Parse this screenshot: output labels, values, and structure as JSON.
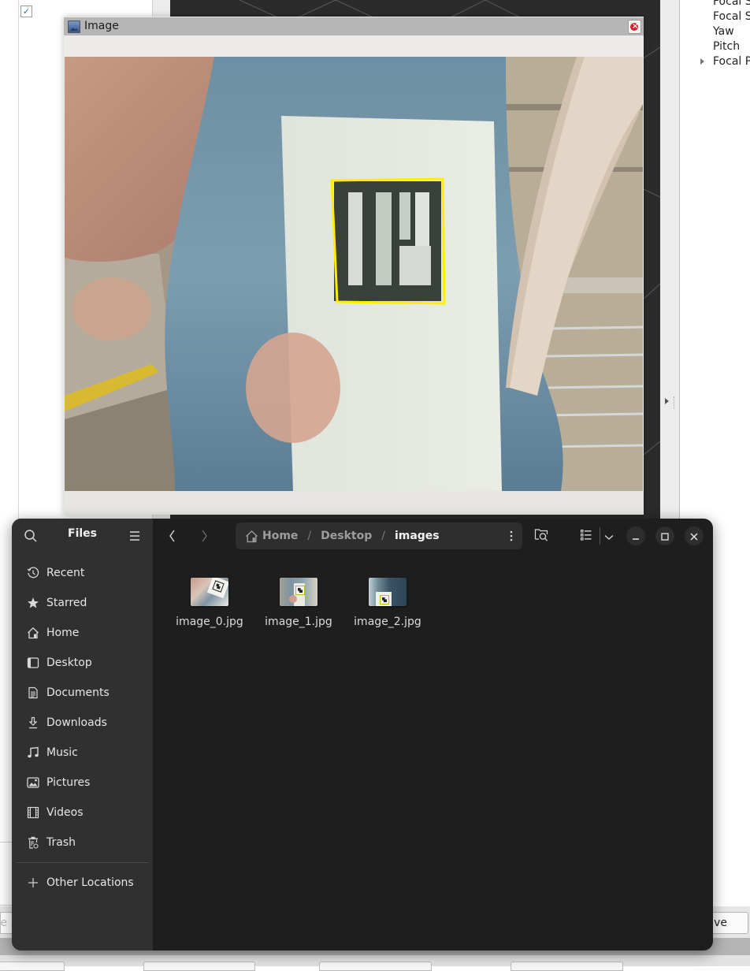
{
  "background_app": {
    "checkbox_checked": true,
    "properties": [
      {
        "label": "Focal S",
        "expandable": false
      },
      {
        "label": "Focal S",
        "expandable": false
      },
      {
        "label": "Yaw",
        "expandable": false
      },
      {
        "label": "Pitch",
        "expandable": false
      },
      {
        "label": "Focal P",
        "expandable": true
      }
    ],
    "partial_field_text": "te",
    "partial_button_text": "ve"
  },
  "image_window": {
    "title": "Image",
    "detection_box_color": "#ffee00"
  },
  "files_window": {
    "app_title": "Files",
    "sidebar": {
      "items": [
        {
          "label": "Recent",
          "icon": "clock-icon"
        },
        {
          "label": "Starred",
          "icon": "star-icon"
        },
        {
          "label": "Home",
          "icon": "home-icon"
        },
        {
          "label": "Desktop",
          "icon": "desktop-icon"
        },
        {
          "label": "Documents",
          "icon": "document-icon"
        },
        {
          "label": "Downloads",
          "icon": "download-icon"
        },
        {
          "label": "Music",
          "icon": "music-icon"
        },
        {
          "label": "Pictures",
          "icon": "picture-icon"
        },
        {
          "label": "Videos",
          "icon": "video-icon"
        },
        {
          "label": "Trash",
          "icon": "trash-icon"
        }
      ],
      "other_locations": "Other Locations"
    },
    "path": [
      {
        "label": "Home",
        "icon": "home-icon"
      },
      {
        "label": "Desktop"
      },
      {
        "label": "images"
      }
    ],
    "path_separator": "/",
    "files": [
      {
        "name": "image_0.jpg"
      },
      {
        "name": "image_1.jpg"
      },
      {
        "name": "image_2.jpg"
      }
    ]
  }
}
